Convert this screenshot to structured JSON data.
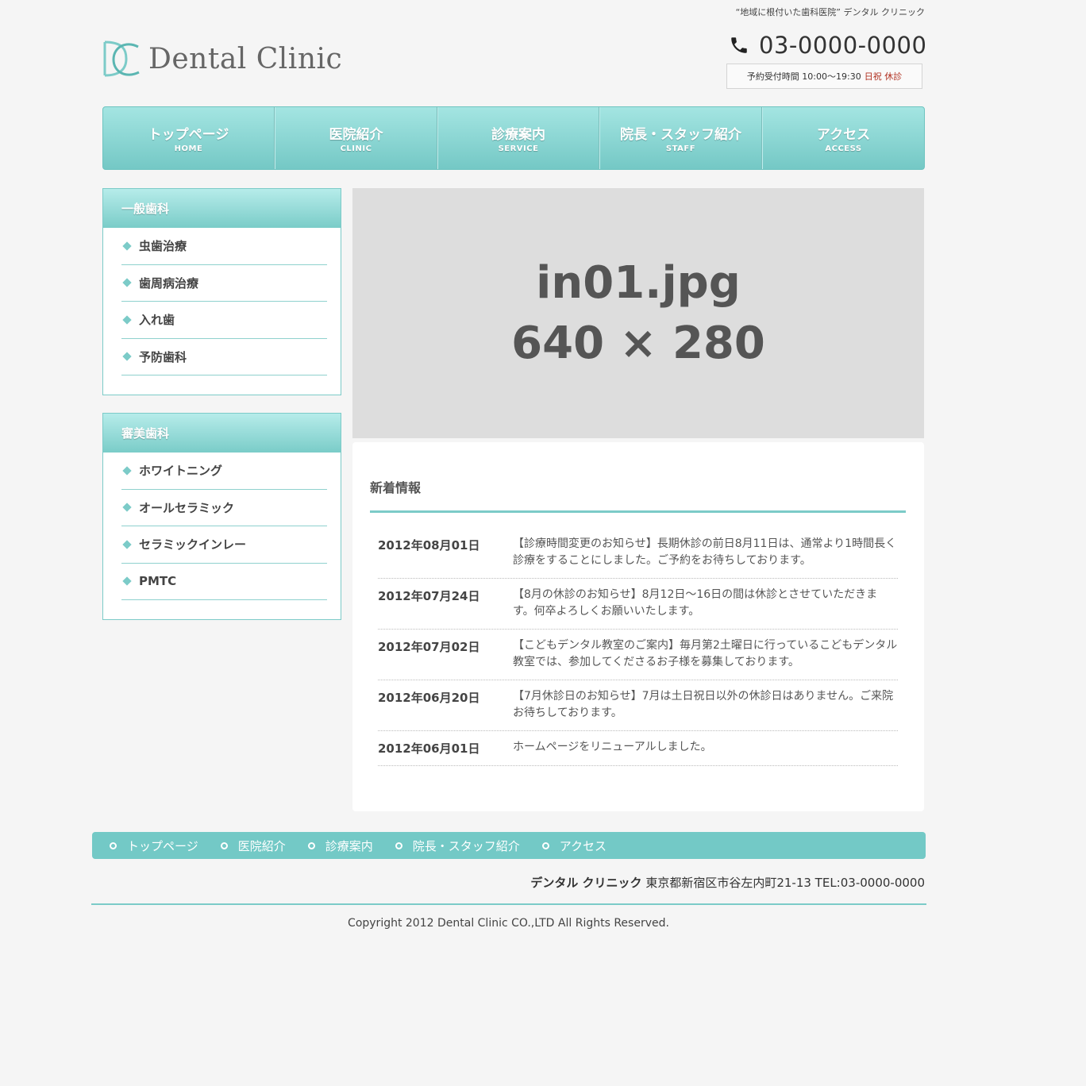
{
  "header": {
    "tagline": "“地域に根付いた歯科医院” デンタル クリニック",
    "logo_text": "Dental Clinic",
    "phone": "03-0000-0000",
    "hours_label": "予約受付時間 10:00～19:30",
    "hours_closed": "日祝 休診"
  },
  "nav": [
    {
      "ja": "トップページ",
      "en": "HOME"
    },
    {
      "ja": "医院紹介",
      "en": "CLINIC"
    },
    {
      "ja": "診療案内",
      "en": "SERVICE"
    },
    {
      "ja": "院長・スタッフ紹介",
      "en": "STAFF"
    },
    {
      "ja": "アクセス",
      "en": "ACCESS"
    }
  ],
  "sidebar": [
    {
      "title": "一般歯科",
      "items": [
        "虫歯治療",
        "歯周病治療",
        "入れ歯",
        "予防歯科"
      ]
    },
    {
      "title": "審美歯科",
      "items": [
        "ホワイトニング",
        "オールセラミック",
        "セラミックインレー",
        "PMTC"
      ]
    }
  ],
  "hero": {
    "line1": "in01.jpg",
    "line2": "640 × 280"
  },
  "news": {
    "title": "新着情報",
    "items": [
      {
        "date": "2012年08月01日",
        "text": "【診療時間変更のお知らせ】長期休診の前日8月11日は、通常より1時間長く診療をすることにしました。ご予約をお待ちしております。"
      },
      {
        "date": "2012年07月24日",
        "text": "【8月の休診のお知らせ】8月12日～16日の間は休診とさせていただきます。何卒よろしくお願いいたします。"
      },
      {
        "date": "2012年07月02日",
        "text": "【こどもデンタル教室のご案内】毎月第2土曜日に行っているこどもデンタル教室では、参加してくださるお子様を募集しております。"
      },
      {
        "date": "2012年06月20日",
        "text": "【7月休診日のお知らせ】7月は土日祝日以外の休診日はありません。ご来院お待ちしております。"
      },
      {
        "date": "2012年06月01日",
        "text": "ホームページをリニューアルしました。"
      }
    ]
  },
  "footer": {
    "nav": [
      "トップページ",
      "医院紹介",
      "診療案内",
      "院長・スタッフ紹介",
      "アクセス"
    ],
    "clinic_name": "デンタル クリニック",
    "address": "東京都新宿区市谷左内町21-13 TEL:03-0000-0000",
    "copyright": "Copyright 2012 Dental Clinic CO.,LTD All Rights Reserved."
  },
  "colors": {
    "accent": "#7ccbc8",
    "closed": "#b03020",
    "background": "#f5f5f5"
  },
  "icons": {
    "logo": "dc-monogram-icon",
    "phone": "phone-icon",
    "bullet": "diamond-bullet-icon",
    "footer_bullet": "circle-bullet-icon"
  }
}
